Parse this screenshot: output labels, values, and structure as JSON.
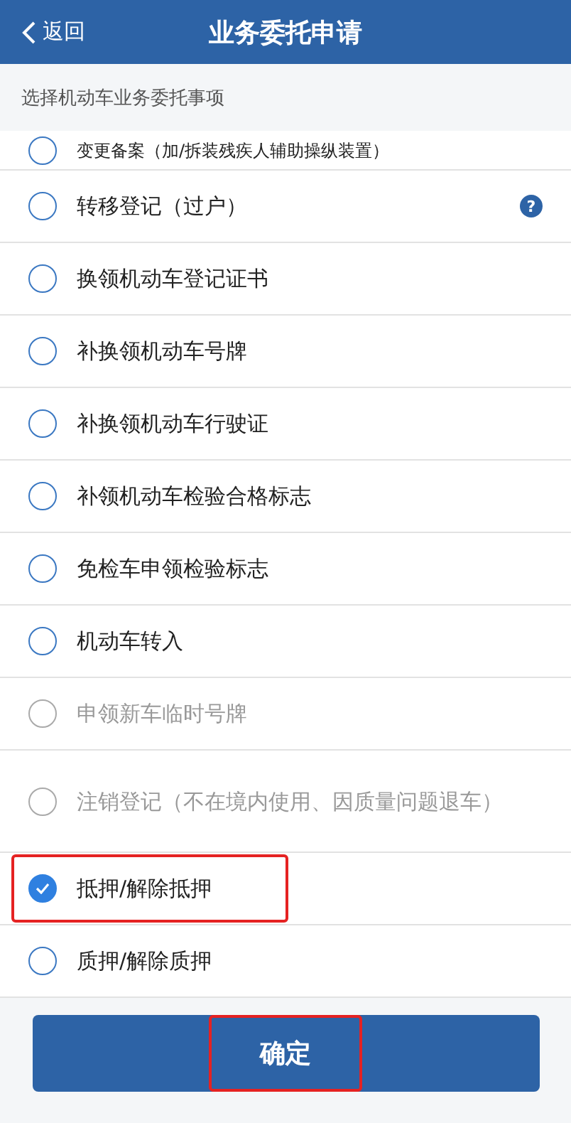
{
  "header": {
    "back": "返回",
    "title": "业务委托申请"
  },
  "subheader": "选择机动车业务委托事项",
  "items": [
    {
      "label": "变更备案（加/拆装残疾人辅助操纵装置）",
      "selected": false,
      "disabled": false,
      "cut": true
    },
    {
      "label": "转移登记（过户）",
      "selected": false,
      "disabled": false,
      "help": "?"
    },
    {
      "label": "换领机动车登记证书",
      "selected": false,
      "disabled": false
    },
    {
      "label": "补换领机动车号牌",
      "selected": false,
      "disabled": false
    },
    {
      "label": "补换领机动车行驶证",
      "selected": false,
      "disabled": false
    },
    {
      "label": "补领机动车检验合格标志",
      "selected": false,
      "disabled": false
    },
    {
      "label": "免检车申领检验标志",
      "selected": false,
      "disabled": false
    },
    {
      "label": "机动车转入",
      "selected": false,
      "disabled": false
    },
    {
      "label": "申领新车临时号牌",
      "selected": false,
      "disabled": true
    },
    {
      "label": "注销登记（不在境内使用、因质量问题退车）",
      "selected": false,
      "disabled": true
    },
    {
      "label": "抵押/解除抵押",
      "selected": true,
      "disabled": false,
      "annotated": true
    },
    {
      "label": "质押/解除质押",
      "selected": false,
      "disabled": false
    }
  ],
  "confirm": {
    "label": "确定",
    "annotated": true
  }
}
